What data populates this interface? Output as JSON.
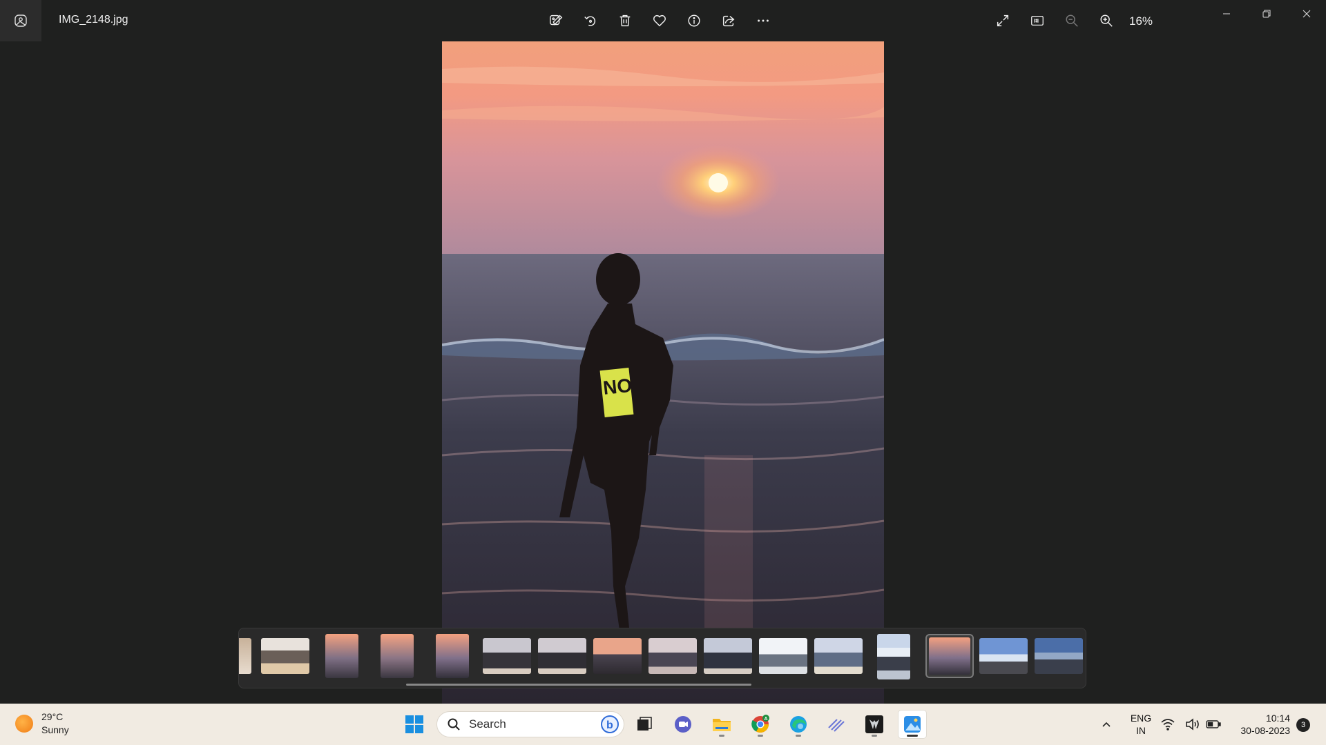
{
  "window": {
    "file_name": "IMG_2148.jpg",
    "zoom_level": "16%"
  },
  "toolbar": {
    "icons": [
      "edit-image-icon",
      "rotate-icon",
      "delete-icon",
      "favorite-heart-icon",
      "info-icon",
      "share-icon",
      "more-options-icon"
    ],
    "right_icons": [
      "fullscreen-icon",
      "actual-size-icon",
      "zoom-out-icon",
      "zoom-in-icon"
    ]
  },
  "filmstrip": {
    "thumbnail_count": 16,
    "selected_index": 13
  },
  "taskbar": {
    "weather_temp": "29°C",
    "weather_desc": "Sunny",
    "search_label": "Search",
    "apps": [
      "start-icon",
      "task-view-icon",
      "teams-chat-icon",
      "file-explorer-icon",
      "chrome-icon",
      "edge-icon",
      "unknown-app-icon",
      "predator-icon",
      "photos-icon"
    ],
    "lang_line1": "ENG",
    "lang_line2": "IN",
    "time": "10:14",
    "date": "30-08-2023",
    "notification_count": "3"
  }
}
